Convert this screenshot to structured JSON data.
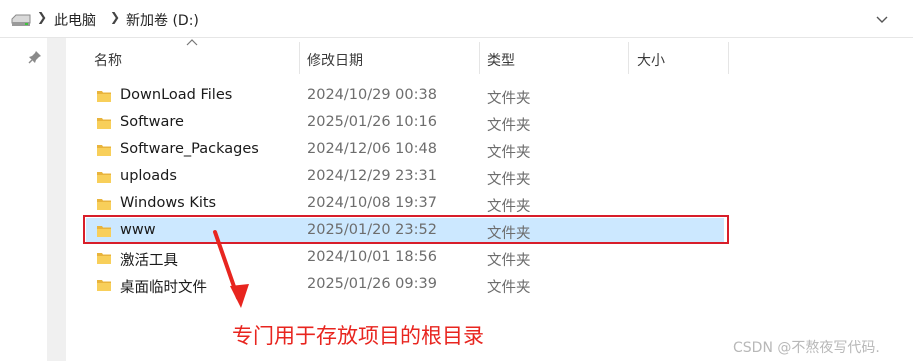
{
  "address_bar": {
    "breadcrumbs": [
      "此电脑",
      "新加卷 (D:)"
    ],
    "drive_icon": "drive-icon",
    "dropdown_icon": "chevron-down-icon"
  },
  "columns": {
    "name": "名称",
    "modified": "修改日期",
    "type": "类型",
    "size": "大小",
    "sorted_by": "名称"
  },
  "files": [
    {
      "name": "DownLoad Files",
      "modified": "2024/10/29 00:38",
      "type": "文件夹"
    },
    {
      "name": "Software",
      "modified": "2025/01/26 10:16",
      "type": "文件夹"
    },
    {
      "name": "Software_Packages",
      "modified": "2024/12/06 10:48",
      "type": "文件夹"
    },
    {
      "name": "uploads",
      "modified": "2024/12/29 23:31",
      "type": "文件夹"
    },
    {
      "name": "Windows Kits",
      "modified": "2024/10/08 19:37",
      "type": "文件夹"
    },
    {
      "name": "www",
      "modified": "2025/01/20 23:52",
      "type": "文件夹",
      "selected": true
    },
    {
      "name": "激活工具",
      "modified": "2024/10/01 18:56",
      "type": "文件夹"
    },
    {
      "name": "桌面临时文件",
      "modified": "2025/01/26 09:39",
      "type": "文件夹"
    }
  ],
  "annotation": {
    "text": "专门用于存放项目的根目录",
    "color": "#e8251f"
  },
  "watermark": "CSDN @不熬夜写代码.",
  "colors": {
    "selection": "#cce8ff",
    "folder": "#f4c553",
    "highlight": "#d81e2a"
  }
}
